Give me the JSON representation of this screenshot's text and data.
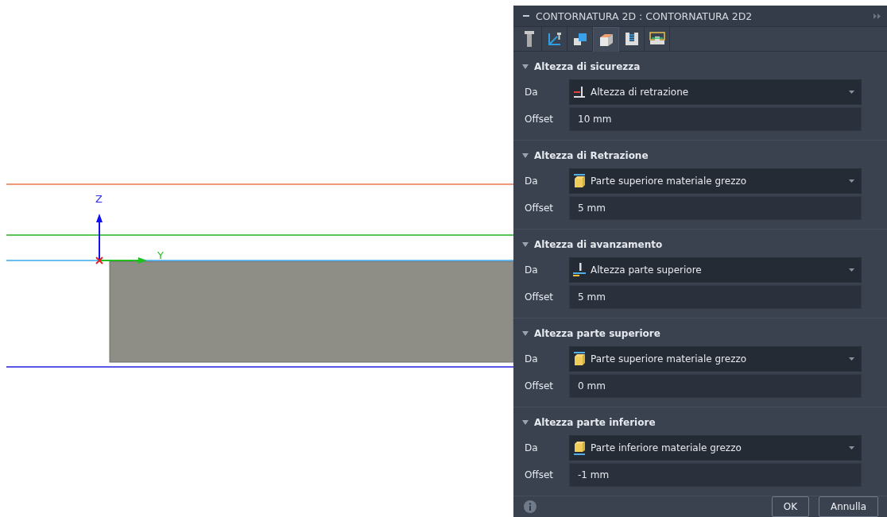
{
  "viewport": {
    "axis_labels": [
      "Z",
      "Y"
    ]
  },
  "panel": {
    "title": "CONTORNATURA 2D : CONTORNATURA 2D2",
    "tabs": [
      {
        "kind": "tool",
        "selected": false
      },
      {
        "kind": "geometry",
        "selected": false
      },
      {
        "kind": "boxes",
        "selected": false
      },
      {
        "kind": "stock",
        "selected": true
      },
      {
        "kind": "passes",
        "selected": false
      },
      {
        "kind": "linking",
        "selected": false
      }
    ],
    "sections": [
      {
        "title": "Altezza di sicurezza",
        "expanded": true,
        "from_label": "Da",
        "from": {
          "kind": "retraction",
          "value": "Altezza di retrazione"
        },
        "offset_label": "Offset",
        "offset": "10 mm"
      },
      {
        "title": "Altezza di Retrazione",
        "expanded": true,
        "from_label": "Da",
        "from": {
          "kind": "stock_top",
          "value": "Parte superiore materiale grezzo"
        },
        "offset_label": "Offset",
        "offset": "5 mm"
      },
      {
        "title": "Altezza di avanzamento",
        "expanded": true,
        "from_label": "Da",
        "from": {
          "kind": "top",
          "value": "Altezza parte superiore"
        },
        "offset_label": "Offset",
        "offset": "5 mm"
      },
      {
        "title": "Altezza parte superiore",
        "expanded": true,
        "from_label": "Da",
        "from": {
          "kind": "stock_top",
          "value": "Parte superiore materiale grezzo"
        },
        "offset_label": "Offset",
        "offset": "0 mm"
      },
      {
        "title": "Altezza parte inferiore",
        "expanded": true,
        "from_label": "Da",
        "from": {
          "kind": "stock_bottom",
          "value": "Parte inferiore materiale grezzo"
        },
        "offset_label": "Offset",
        "offset": "-1 mm"
      }
    ],
    "buttons": [
      "OK",
      "Annulla"
    ]
  }
}
